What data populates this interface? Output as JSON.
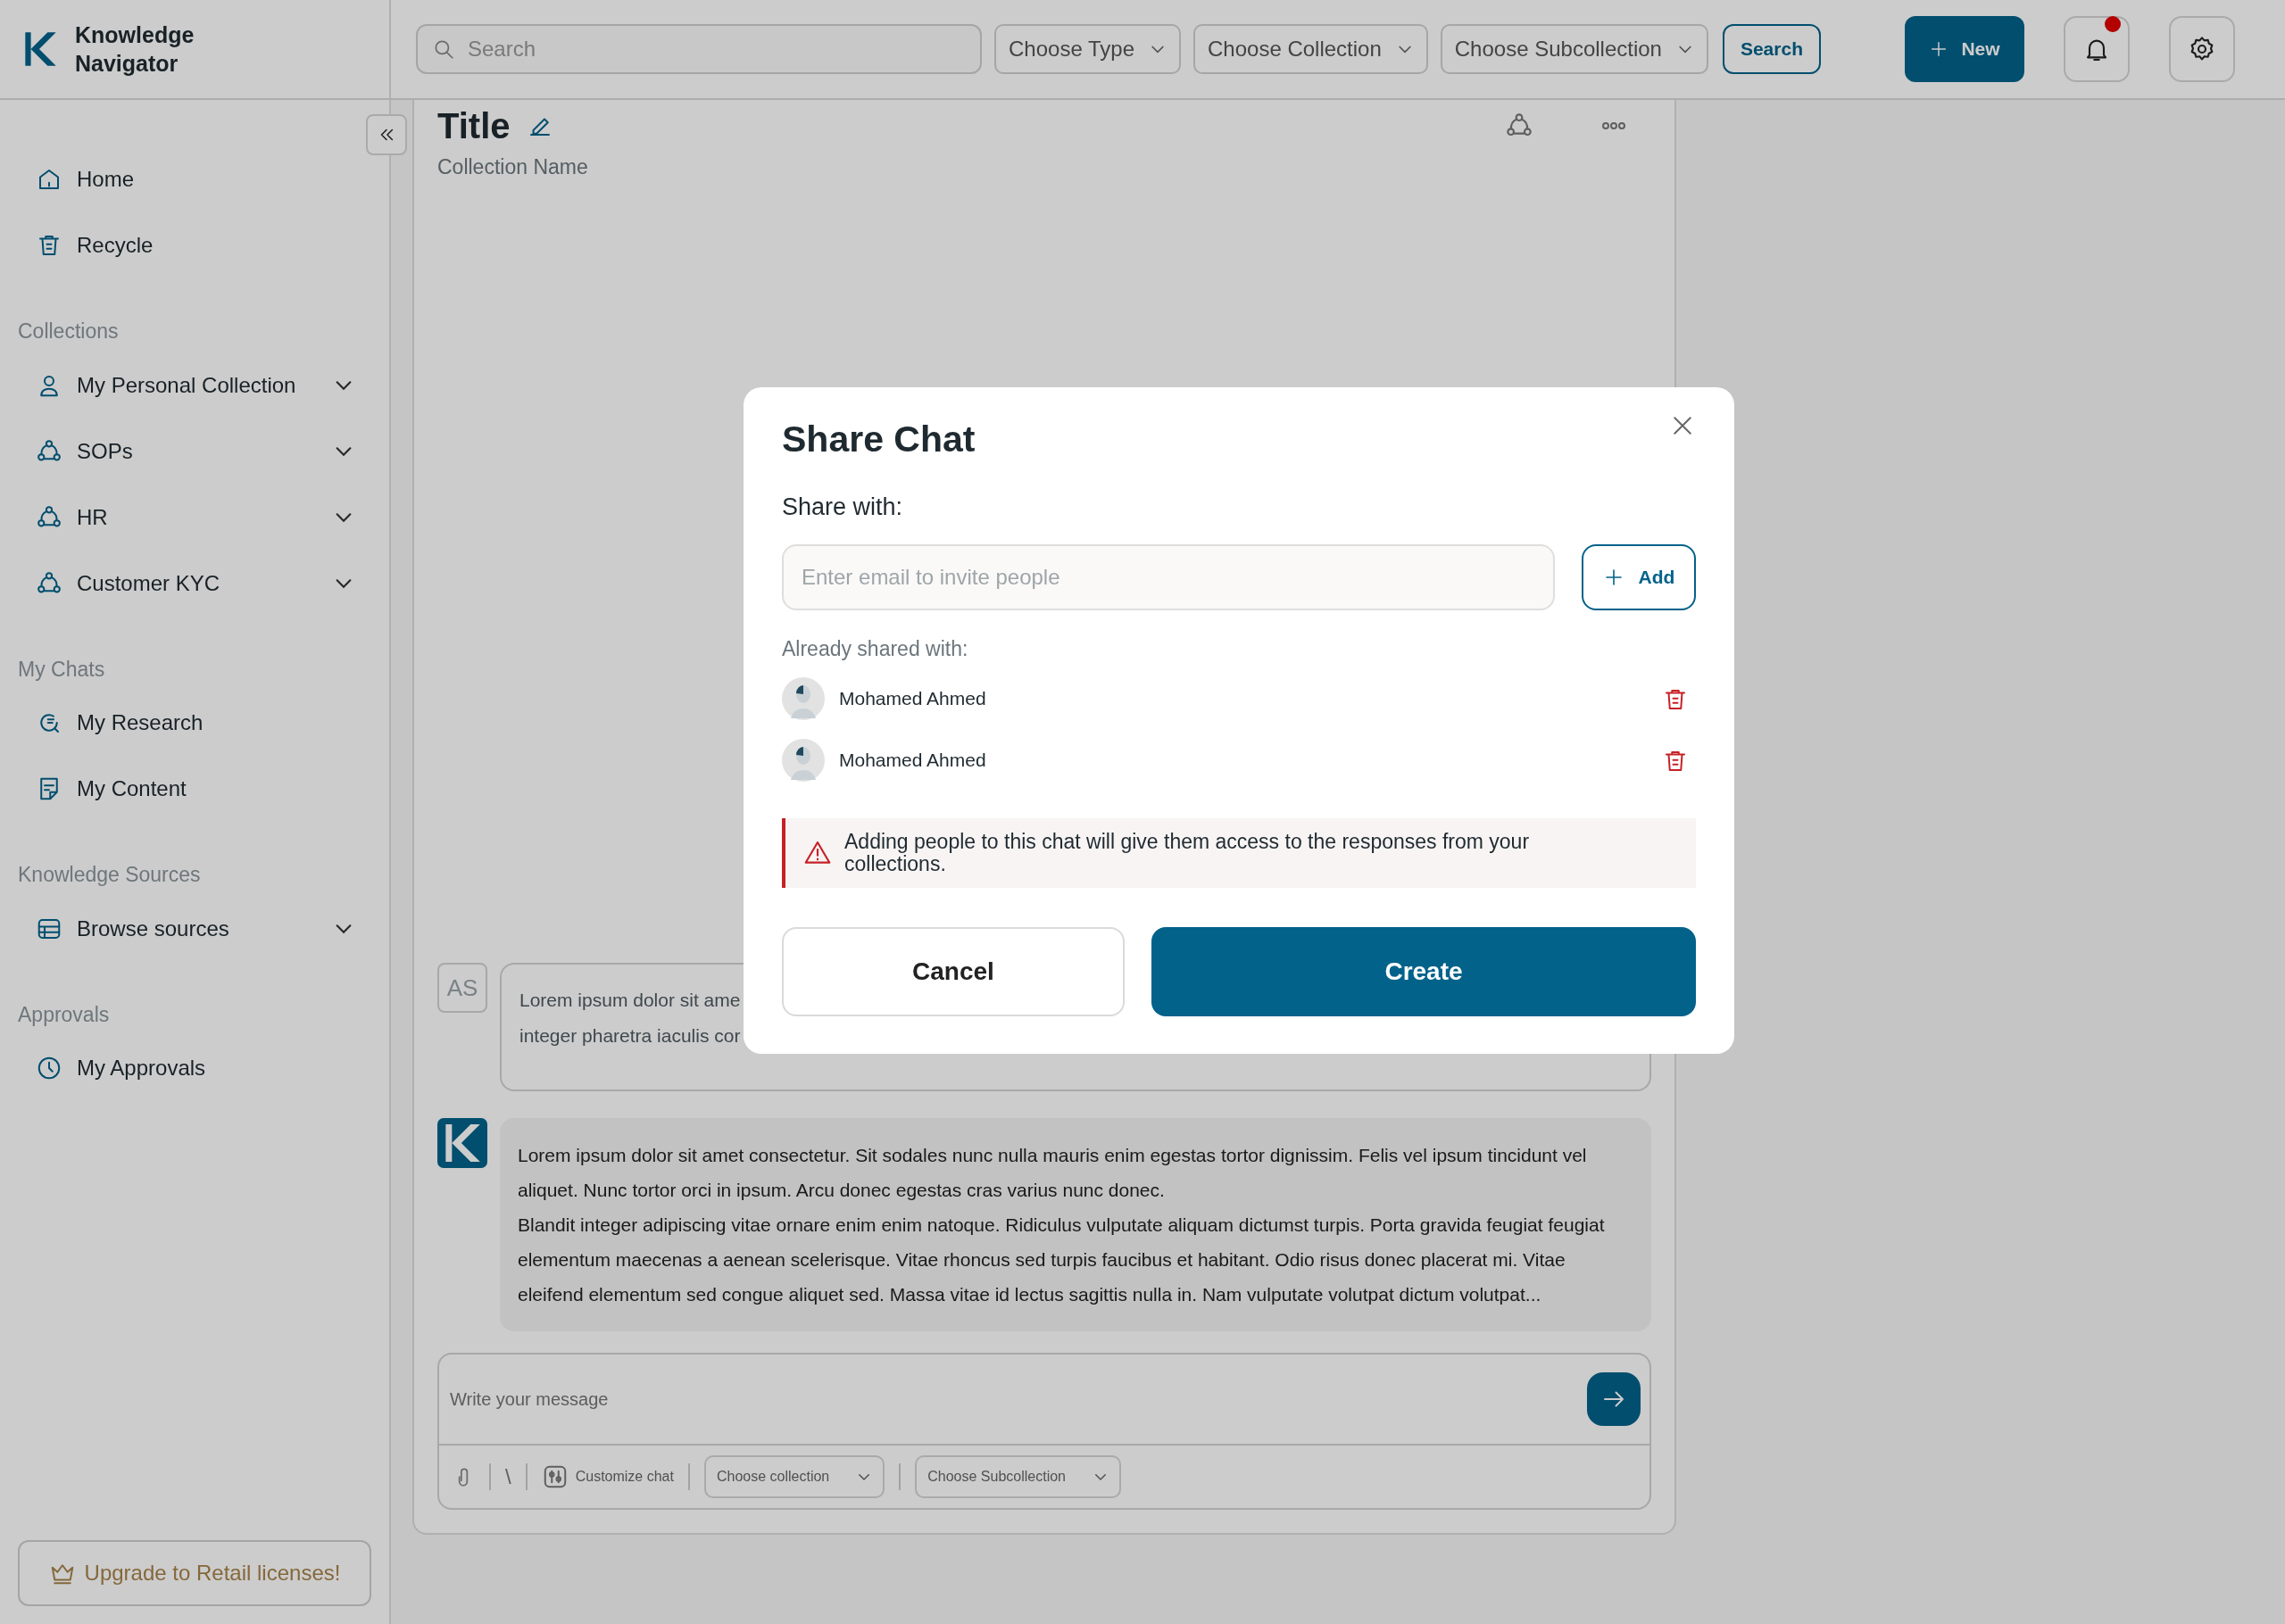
{
  "app": {
    "name": "Knowledge Navigator"
  },
  "topbar": {
    "search_placeholder": "Search",
    "filters": [
      "Choose Type",
      "Choose Collection",
      "Choose Subcollection"
    ],
    "search_button": "Search",
    "new_button": "New",
    "notifications_unread": true
  },
  "sidebar": {
    "items": [
      {
        "label": "Home",
        "expandable": false
      },
      {
        "label": "Recycle",
        "expandable": false
      }
    ],
    "sections": [
      {
        "heading": "Collections",
        "items": [
          {
            "label": "My Personal Collection",
            "expandable": true
          },
          {
            "label": "SOPs",
            "expandable": true
          },
          {
            "label": "HR",
            "expandable": true
          },
          {
            "label": "Customer KYC",
            "expandable": true
          }
        ]
      },
      {
        "heading": "My Chats",
        "items": [
          {
            "label": "My Research",
            "expandable": false
          },
          {
            "label": "My Content",
            "expandable": false
          }
        ]
      },
      {
        "heading": "Knowledge Sources",
        "items": [
          {
            "label": "Browse sources",
            "expandable": true
          }
        ]
      },
      {
        "heading": "Approvals",
        "items": [
          {
            "label": "My Approvals",
            "expandable": false
          }
        ]
      }
    ],
    "upgrade_button": "Upgrade to Retail licenses!"
  },
  "chat": {
    "title": "Title",
    "subtitle": "Collection Name",
    "messages": [
      {
        "kind": "user",
        "avatar": "AS",
        "lines": [
          "Lorem ipsum dolor sit ame",
          "integer pharetra iaculis cor"
        ]
      },
      {
        "kind": "assistant",
        "paragraphs": [
          "Lorem ipsum dolor sit amet consectetur. Sit sodales nunc nulla mauris enim egestas tortor dignissim. Felis vel ipsum tincidunt vel aliquet. Nunc tortor orci in ipsum. Arcu donec egestas cras varius nunc donec.",
          "Blandit integer adipiscing vitae ornare enim enim natoque. Ridiculus vulputate aliquam dictumst turpis. Porta gravida feugiat feugiat elementum maecenas a aenean scelerisque. Vitae rhoncus sed turpis faucibus et habitant. Odio risus donec placerat mi. Vitae eleifend elementum sed congue aliquet sed. Massa vitae id lectus sagittis nulla in. Nam vulputate volutpat dictum volutpat..."
        ]
      }
    ],
    "composer": {
      "placeholder": "Write your message",
      "slash": "\\",
      "customize": "Customize chat",
      "selects": [
        "Choose collection",
        "Choose Subcollection"
      ]
    }
  },
  "modal": {
    "title": "Share Chat",
    "share_label": "Share with:",
    "email_placeholder": "Enter email to invite people",
    "add_button": "Add",
    "shared_label": "Already shared with:",
    "people": [
      {
        "name": "Mohamed Ahmed"
      },
      {
        "name": "Mohamed Ahmed"
      }
    ],
    "warning": "Adding people to this chat will give them access to the responses from your collections.",
    "cancel_button": "Cancel",
    "create_button": "Create"
  }
}
